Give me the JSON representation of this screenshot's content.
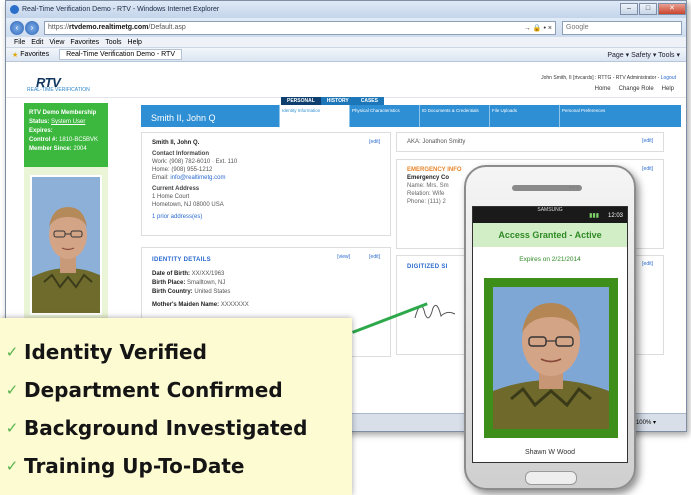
{
  "window": {
    "title": "Real-Time Verification Demo - RTV - Windows Internet Explorer",
    "controls": [
      "–",
      "□",
      "✕"
    ]
  },
  "addressbar": {
    "url_prefix": "https://",
    "url_domain": "rtvdemo.realtimetg.com",
    "url_path": "/Default.asp",
    "tools": "→ 🔒 • ×",
    "search_placeholder": "Google"
  },
  "menu": [
    "File",
    "Edit",
    "View",
    "Favorites",
    "Tools",
    "Help"
  ],
  "favorites": {
    "label": "Favorites",
    "tab": "Real-Time Verification Demo - RTV",
    "commands": "Page ▾  Safety ▾  Tools ▾"
  },
  "rtv": {
    "logo": "RTV",
    "logo_sub": "REAL-TIME VERIFICATION",
    "user_line": "John Smith, II [rtvcards] : RTTG - RTV Administrator -",
    "logout": "Logout",
    "role_buttons": [
      "Home",
      "Change Role",
      "Help"
    ]
  },
  "membership": {
    "title": "RTV Demo Membership",
    "status_label": "Status:",
    "status_value": "System User",
    "expires_label": "Expires:",
    "control_label": "Control #:",
    "control_value": "1810-BC5BVK",
    "member_since_label": "Member Since:",
    "member_since_value": "2004"
  },
  "tabs": [
    "PERSONAL",
    "HISTORY",
    "CASES"
  ],
  "person": {
    "name": "Smith II, John Q",
    "subtabs": [
      "Identity Information",
      "Physical Characteristics",
      "ID Documents & Credentials",
      "File Uploads",
      "Personal Preferences"
    ]
  },
  "contact": {
    "name": "Smith II, John Q.",
    "header": "Contact Information",
    "work": "Work: (908) 782-6010 · Ext. 110",
    "home": "Home: (908) 955-1212",
    "email_label": "Email:",
    "email": "info@realtimetg.com",
    "address_header": "Current Address",
    "address1": "1 Home Court",
    "address2": "Hometown, NJ 08000 USA",
    "prior": "1 prior address(es)",
    "edit": "[edit]"
  },
  "aka": {
    "text": "AKA: Jonathon Smitty",
    "edit": "[edit]"
  },
  "emergency": {
    "header": "EMERGENCY INFO",
    "contact": "Emergency Co",
    "name": "Name: Mrs. Sm",
    "relation": "Relation: Wife",
    "phone": "Phone: (111) 2",
    "edit": "[edit]"
  },
  "identity": {
    "header": "IDENTITY DETAILS",
    "dob_label": "Date of Birth:",
    "dob": "XX/XX/1963",
    "birthplace_label": "Birth Place:",
    "birthplace": "Smalltown, NJ",
    "country_label": "Birth Country:",
    "country": "United States",
    "maiden_label": "Mother's Maiden Name:",
    "maiden": "XXXXXXX",
    "view": "[view]",
    "edit": "[edit]"
  },
  "digitized": {
    "header": "DIGITIZED SI",
    "edit": "[edit]"
  },
  "statusbar": {
    "zoom": "⊕100%  ▾"
  },
  "overlay": {
    "items": [
      "Identity Verified",
      "Department Confirmed",
      "Background Investigated",
      "Training Up-To-Date"
    ],
    "check": "✓"
  },
  "phone": {
    "brand": "SAMSUNG",
    "time": "12:03",
    "signal": "▮▮▮",
    "access": "Access Granted - Active",
    "expires": "Expires on 2/21/2014",
    "name": "Shawn W Wood",
    "sensors": "• • ○"
  },
  "colors": {
    "accent_blue": "#2f8fd4",
    "access_green": "#2f8a25",
    "membership_green": "#3db83f",
    "overlay_bg": "#fdfbd2",
    "check_green": "#58b34d"
  }
}
